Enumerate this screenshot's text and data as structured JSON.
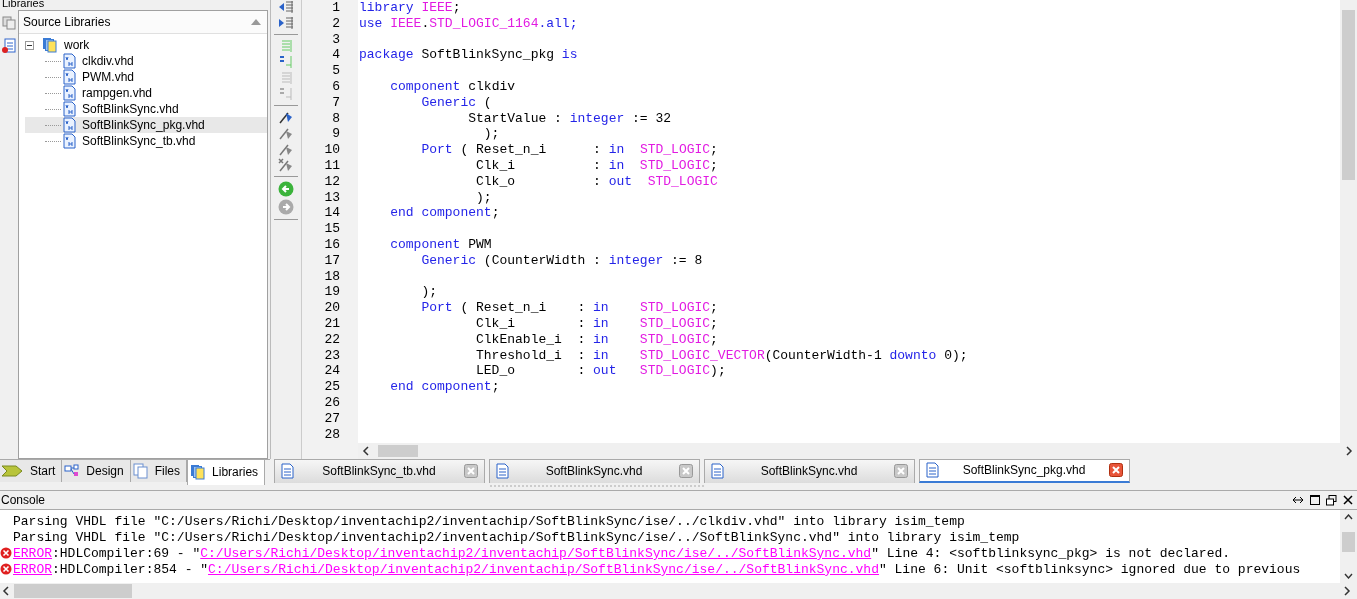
{
  "libraries_panel": {
    "title": "Libraries",
    "tree_header": "Source Libraries",
    "tree": [
      {
        "label": "work",
        "expanded": true,
        "selected": false,
        "children": [
          {
            "label": "clkdiv.vhd",
            "selected": false
          },
          {
            "label": "PWM.vhd",
            "selected": false
          },
          {
            "label": "rampgen.vhd",
            "selected": false
          },
          {
            "label": "SoftBlinkSync.vhd",
            "selected": false
          },
          {
            "label": "SoftBlinkSync_pkg.vhd",
            "selected": true
          },
          {
            "label": "SoftBlinkSync_tb.vhd",
            "selected": false
          }
        ]
      }
    ],
    "tabs": [
      {
        "label": "Start",
        "kind": "start",
        "selected": false
      },
      {
        "label": "Design",
        "kind": "design",
        "selected": false
      },
      {
        "label": "Files",
        "kind": "files",
        "selected": false
      },
      {
        "label": "Libraries",
        "kind": "libraries",
        "selected": true
      }
    ]
  },
  "editor": {
    "lines": [
      {
        "number": "1",
        "segments": [
          {
            "text": "library ",
            "kind": "keyword"
          },
          {
            "text": "IEEE",
            "kind": "type"
          },
          {
            "text": ";",
            "kind": "plain"
          }
        ]
      },
      {
        "number": "2",
        "segments": [
          {
            "text": "use ",
            "kind": "keyword"
          },
          {
            "text": "IEEE",
            "kind": "type"
          },
          {
            "text": ".",
            "kind": "plain"
          },
          {
            "text": "STD_LOGIC_1164",
            "kind": "type"
          },
          {
            "text": ".all;",
            "kind": "keyword"
          }
        ]
      },
      {
        "number": "3"
      },
      {
        "number": "4",
        "segments": [
          {
            "text": "package",
            "kind": "keyword"
          },
          {
            "text": " SoftBlinkSync_pkg ",
            "kind": "plain"
          },
          {
            "text": "is",
            "kind": "keyword"
          }
        ]
      },
      {
        "number": "5"
      },
      {
        "number": "6",
        "segments": [
          {
            "text": "    component",
            "kind": "keyword"
          },
          {
            "text": " clkdiv",
            "kind": "plain"
          }
        ]
      },
      {
        "number": "7",
        "segments": [
          {
            "text": "        Generic",
            "kind": "keyword"
          },
          {
            "text": " (",
            "kind": "plain"
          }
        ]
      },
      {
        "number": "8",
        "segments": [
          {
            "text": "              StartValue : ",
            "kind": "plain"
          },
          {
            "text": "integer",
            "kind": "keyword"
          },
          {
            "text": " := 32",
            "kind": "plain"
          }
        ]
      },
      {
        "number": "9",
        "segments": [
          {
            "text": "                );",
            "kind": "plain"
          }
        ]
      },
      {
        "number": "10",
        "segments": [
          {
            "text": "        Port",
            "kind": "keyword"
          },
          {
            "text": " ( Reset_n_i      : ",
            "kind": "plain"
          },
          {
            "text": "in  ",
            "kind": "keyword"
          },
          {
            "text": "STD_LOGIC",
            "kind": "type"
          },
          {
            "text": ";",
            "kind": "plain"
          }
        ]
      },
      {
        "number": "11",
        "segments": [
          {
            "text": "               Clk_i          : ",
            "kind": "plain"
          },
          {
            "text": "in  ",
            "kind": "keyword"
          },
          {
            "text": "STD_LOGIC",
            "kind": "type"
          },
          {
            "text": ";",
            "kind": "plain"
          }
        ]
      },
      {
        "number": "12",
        "segments": [
          {
            "text": "               Clk_o          : ",
            "kind": "plain"
          },
          {
            "text": "out  ",
            "kind": "keyword"
          },
          {
            "text": "STD_LOGIC",
            "kind": "type"
          }
        ]
      },
      {
        "number": "13",
        "segments": [
          {
            "text": "               );",
            "kind": "plain"
          }
        ]
      },
      {
        "number": "14",
        "segments": [
          {
            "text": "    end component",
            "kind": "keyword"
          },
          {
            "text": ";",
            "kind": "plain"
          }
        ]
      },
      {
        "number": "15"
      },
      {
        "number": "16",
        "segments": [
          {
            "text": "    component",
            "kind": "keyword"
          },
          {
            "text": " PWM",
            "kind": "plain"
          }
        ]
      },
      {
        "number": "17",
        "segments": [
          {
            "text": "        Generic",
            "kind": "keyword"
          },
          {
            "text": " (CounterWidth : ",
            "kind": "plain"
          },
          {
            "text": "integer",
            "kind": "keyword"
          },
          {
            "text": " := 8",
            "kind": "plain"
          }
        ]
      },
      {
        "number": "18"
      },
      {
        "number": "19",
        "segments": [
          {
            "text": "        );",
            "kind": "plain"
          }
        ]
      },
      {
        "number": "20",
        "segments": [
          {
            "text": "        Port",
            "kind": "keyword"
          },
          {
            "text": " ( Reset_n_i    : ",
            "kind": "plain"
          },
          {
            "text": "in    ",
            "kind": "keyword"
          },
          {
            "text": "STD_LOGIC",
            "kind": "type"
          },
          {
            "text": ";",
            "kind": "plain"
          }
        ]
      },
      {
        "number": "21",
        "segments": [
          {
            "text": "               Clk_i        : ",
            "kind": "plain"
          },
          {
            "text": "in    ",
            "kind": "keyword"
          },
          {
            "text": "STD_LOGIC",
            "kind": "type"
          },
          {
            "text": ";",
            "kind": "plain"
          }
        ]
      },
      {
        "number": "22",
        "segments": [
          {
            "text": "               ClkEnable_i  : ",
            "kind": "plain"
          },
          {
            "text": "in    ",
            "kind": "keyword"
          },
          {
            "text": "STD_LOGIC",
            "kind": "type"
          },
          {
            "text": ";",
            "kind": "plain"
          }
        ]
      },
      {
        "number": "23",
        "segments": [
          {
            "text": "               Threshold_i  : ",
            "kind": "plain"
          },
          {
            "text": "in    ",
            "kind": "keyword"
          },
          {
            "text": "STD_LOGIC_VECTOR",
            "kind": "type"
          },
          {
            "text": "(CounterWidth-1 ",
            "kind": "plain"
          },
          {
            "text": "downto",
            "kind": "keyword"
          },
          {
            "text": " 0);",
            "kind": "plain"
          }
        ]
      },
      {
        "number": "24",
        "segments": [
          {
            "text": "               LED_o        : ",
            "kind": "plain"
          },
          {
            "text": "out   ",
            "kind": "keyword"
          },
          {
            "text": "STD_LOGIC",
            "kind": "type"
          },
          {
            "text": ");",
            "kind": "plain"
          }
        ]
      },
      {
        "number": "25",
        "segments": [
          {
            "text": "    end component",
            "kind": "keyword"
          },
          {
            "text": ";",
            "kind": "plain"
          }
        ]
      },
      {
        "number": "26"
      },
      {
        "number": "27"
      },
      {
        "number": "28"
      }
    ],
    "tabs": [
      {
        "label": "SoftBlinkSync_tb.vhd",
        "selected": false
      },
      {
        "label": "SoftBlinkSync.vhd",
        "selected": false
      },
      {
        "label": "SoftBlinkSync.vhd",
        "selected": false
      },
      {
        "label": "SoftBlinkSync_pkg.vhd",
        "selected": true
      }
    ]
  },
  "console": {
    "title": "Console",
    "lines": [
      {
        "kind": "info",
        "text": "Parsing VHDL file \"C:/Users/Richi/Desktop/inventachip2/inventachip/SoftBlinkSync/ise/../clkdiv.vhd\" into library isim_temp"
      },
      {
        "kind": "info",
        "text": "Parsing VHDL file \"C:/Users/Richi/Desktop/inventachip2/inventachip/SoftBlinkSync/ise/../SoftBlinkSync.vhd\" into library isim_temp"
      },
      {
        "kind": "error",
        "tag": "ERROR",
        "before": ":HDLCompiler:69 - \"",
        "path": "C:/Users/Richi/Desktop/inventachip2/inventachip/SoftBlinkSync/ise/../SoftBlinkSync.vhd",
        "after": "\" Line 4: <softblinksync_pkg> is not declared."
      },
      {
        "kind": "error",
        "tag": "ERROR",
        "before": ":HDLCompiler:854 - \"",
        "path": "C:/Users/Richi/Desktop/inventachip2/inventachip/SoftBlinkSync/ise/../SoftBlinkSync.vhd",
        "after": "\" Line 6: Unit <softblinksync> ignored due to previous"
      }
    ]
  }
}
